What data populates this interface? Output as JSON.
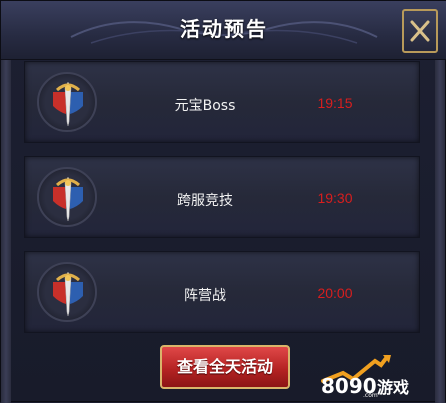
{
  "dialog": {
    "title": "活动预告",
    "close_icon": "close-x-icon"
  },
  "activities": [
    {
      "name": "元宝Boss",
      "time": "19:15",
      "icon": "sword-shield-emblem-icon"
    },
    {
      "name": "跨服竞技",
      "time": "19:30",
      "icon": "sword-shield-emblem-icon"
    },
    {
      "name": "阵营战",
      "time": "20:00",
      "icon": "sword-shield-emblem-icon"
    }
  ],
  "footer": {
    "view_all_label": "查看全天活动"
  },
  "watermark": {
    "brand": "8090游戏",
    "domain": ".com"
  },
  "colors": {
    "time_red": "#d81e1e",
    "button_red": "#b52323",
    "gold_border": "#d9b56a",
    "panel_bg": "#22253a"
  }
}
